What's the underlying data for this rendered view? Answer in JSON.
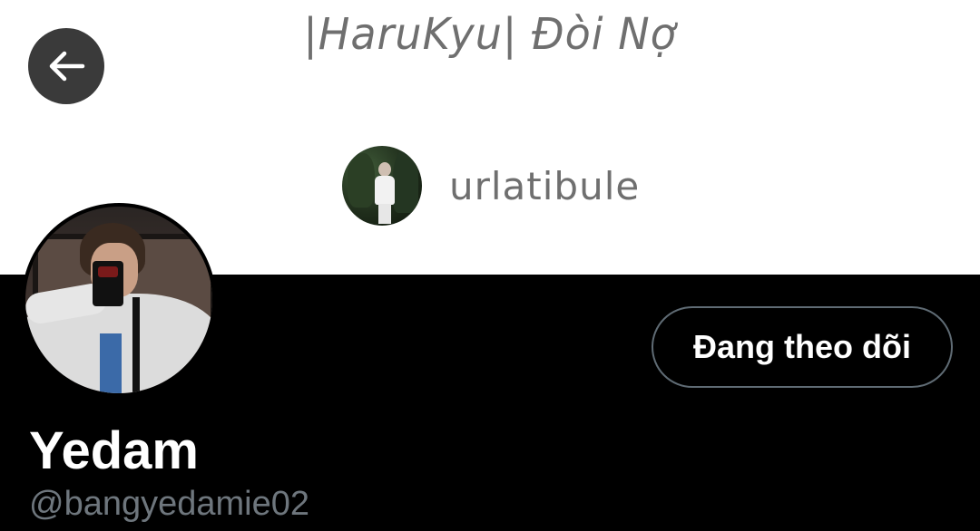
{
  "header": {
    "banner_title": "|HaruKyu| Đòi Nợ",
    "banner_author": "urlatibule"
  },
  "navigation": {
    "back_icon": "arrow-left-icon"
  },
  "profile": {
    "display_name": "Yedam",
    "handle": "@bangyedamie02",
    "follow_button_label": "Đang theo dõi"
  },
  "colors": {
    "page_background": "#000000",
    "banner_background": "#ffffff",
    "banner_text": "#6f6f6f",
    "back_button_bg": "#3a3a3a",
    "follow_border": "#5f6b74",
    "handle_text": "#6e767d",
    "primary_text": "#ffffff"
  }
}
